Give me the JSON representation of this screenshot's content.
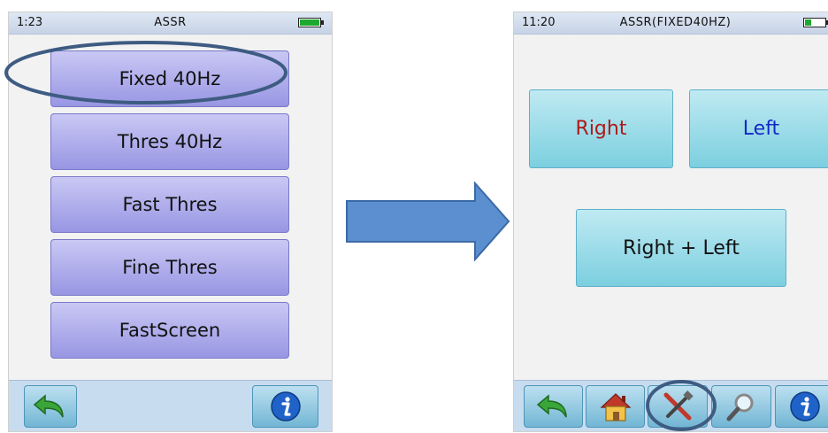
{
  "left_screen": {
    "status": {
      "time": "1:23",
      "title": "ASSR",
      "battery_level": 0.92
    },
    "menu": [
      {
        "label": "Fixed 40Hz"
      },
      {
        "label": "Thres 40Hz"
      },
      {
        "label": "Fast Thres"
      },
      {
        "label": "Fine Thres"
      },
      {
        "label": "FastScreen"
      }
    ],
    "toolbar": [
      "back-icon",
      "info-icon"
    ]
  },
  "right_screen": {
    "status": {
      "time": "11:20",
      "title": "ASSR(FIXED40HZ)",
      "battery_level": 0.3
    },
    "buttons": {
      "right": "Right",
      "left": "Left",
      "both": "Right + Left"
    },
    "toolbar": [
      "back-icon",
      "home-icon",
      "tools-icon",
      "search-icon",
      "info-icon"
    ]
  },
  "colors": {
    "menu_button": "#a9a8ea",
    "ear_button": "#9adbe9",
    "right_text": "#b01818",
    "left_text": "#1428c8",
    "highlight_oval": "#3e5c82",
    "arrow": "#5b8fcf",
    "toolbar_bg": "#c8dcf0"
  }
}
